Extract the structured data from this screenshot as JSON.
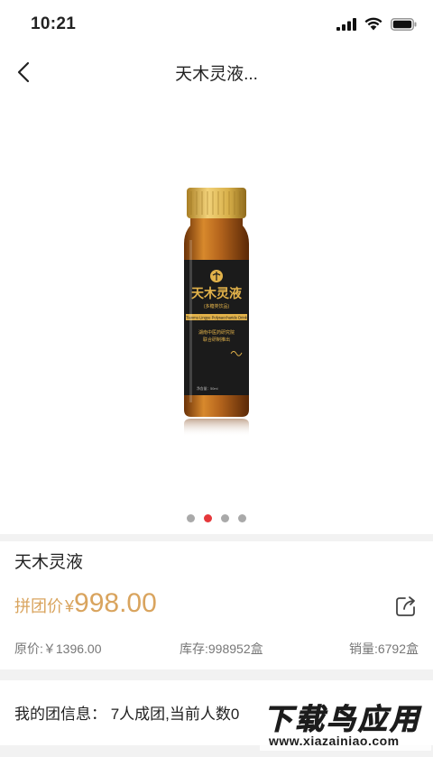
{
  "status_bar": {
    "time": "10:21"
  },
  "nav": {
    "title": "天木灵液..."
  },
  "gallery": {
    "slide_count": 4,
    "active_index": 1,
    "product_label": {
      "brand": "天木灵液",
      "sub": "(多糖类饮品)",
      "english": "Tianmu Lingye Polysaccharide Drink",
      "line1": "湖南中医药研究院",
      "line2": "联合研制推出",
      "volume": "净含量：50ml"
    },
    "colors": {
      "cap": "#d8b04a",
      "liquid": "#b5651d",
      "label": "#1b1b1b",
      "label_gold": "#e2b24a"
    }
  },
  "product": {
    "name": "天木灵液",
    "price_label": "拼团价",
    "price_symbol": "¥",
    "price_value": "998.00",
    "original_price": "原价:￥1396.00",
    "stock": "库存:998952盒",
    "sales": "销量:6792盒",
    "price_color": "#d9a45e"
  },
  "group": {
    "text": "我的团信息：  7人成团,当前人数0"
  },
  "watermark": {
    "title": "下载鸟应用",
    "url": "www.xiazainiao.com"
  }
}
